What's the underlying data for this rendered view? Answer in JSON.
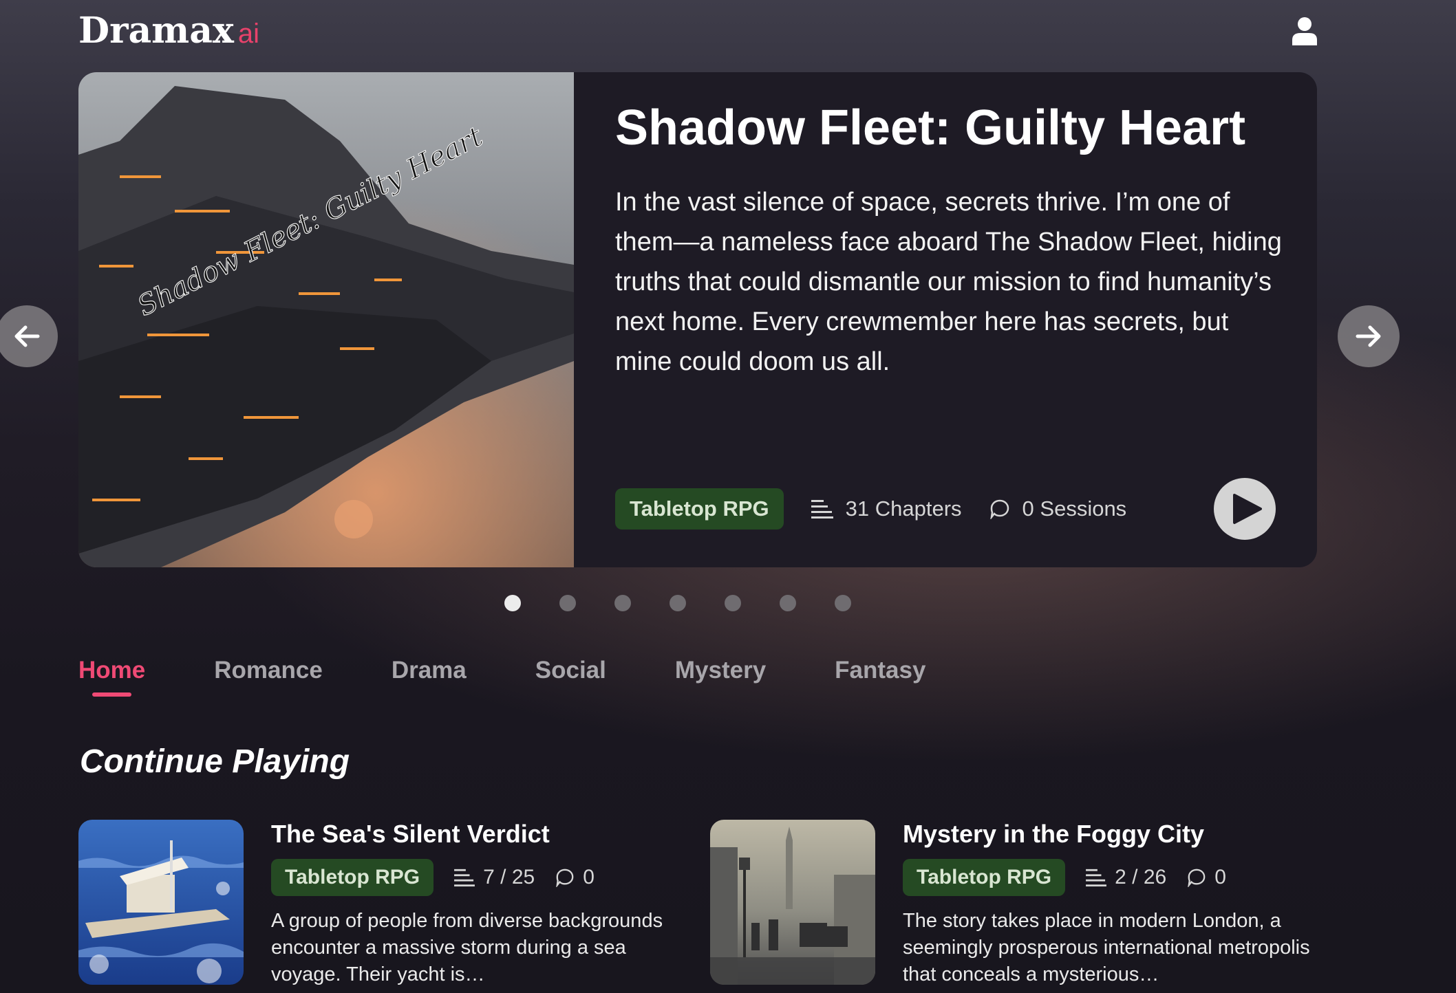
{
  "header": {
    "logo_main": "Dramax",
    "logo_suffix": "ai",
    "user_icon": "user-icon"
  },
  "hero": {
    "cover_text": "Shadow Fleet: Guilty Heart",
    "title": "Shadow Fleet: Guilty Heart",
    "description": "In the vast silence of space, secrets thrive. I’m one of them—a nameless face aboard The Shadow Fleet, hiding truths that could dismantle our mission to find humanity’s next home. Every crewmember here has secrets, but mine could doom us all.",
    "tag": "Tabletop RPG",
    "chapters": "31 Chapters",
    "sessions": "0 Sessions",
    "chapters_icon": "list-icon",
    "sessions_icon": "chat-bubble-icon",
    "play_icon": "play-icon"
  },
  "carousel": {
    "total_slides": 7,
    "active_index": 0,
    "prev_icon": "arrow-left-icon",
    "next_icon": "arrow-right-icon"
  },
  "tabs": [
    {
      "label": "Home",
      "active": true
    },
    {
      "label": "Romance",
      "active": false
    },
    {
      "label": "Drama",
      "active": false
    },
    {
      "label": "Social",
      "active": false
    },
    {
      "label": "Mystery",
      "active": false
    },
    {
      "label": "Fantasy",
      "active": false
    }
  ],
  "continue_playing": {
    "title": "Continue Playing",
    "cards": [
      {
        "title": "The Sea's Silent Verdict",
        "tag": "Tabletop RPG",
        "progress": "7 / 25",
        "sessions": "0",
        "description": "A group of people from diverse backgrounds encounter a massive storm during a sea voyage. Their yacht is…"
      },
      {
        "title": "Mystery in the Foggy City",
        "tag": "Tabletop RPG",
        "progress": "2 / 26",
        "sessions": "0",
        "description": "The story takes place in modern London, a seemingly prosperous international metropolis that conceals a mysterious…"
      }
    ]
  },
  "colors": {
    "accent": "#f04a75",
    "logo_ai": "#e8426b",
    "tag_bg": "#254a23",
    "tag_text": "#d9e6d2"
  }
}
